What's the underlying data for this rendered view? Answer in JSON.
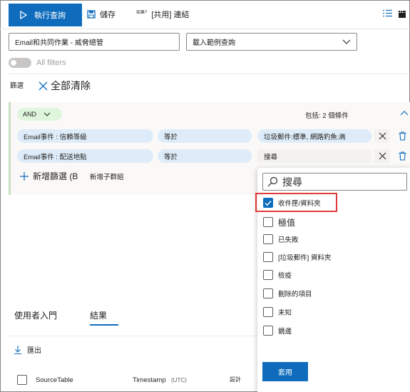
{
  "toolbar": {
    "run_query": "執行查詢",
    "save": "儲存",
    "share_prefix": "如果?",
    "share_link": "[共用] 連結"
  },
  "query": {
    "category_value": "Email和共同作業 - 威脅總管",
    "sample_query_value": "載入範例查詢"
  },
  "filters": {
    "all_filters_label": "All filters",
    "filter_label": "篩選",
    "clear_all": "全部清除",
    "logic_operator": "AND",
    "includes_summary": "包括: 2 個條件",
    "conditions": [
      {
        "field": "Email事件 : 信賴等級",
        "operator": "等於",
        "value": "垃圾郵件:標準, 網路釣魚:高"
      },
      {
        "field": "Email事件 : 配送地點",
        "operator": "等於",
        "value": "搜尋"
      }
    ],
    "add_filter": "新增篩選 (B",
    "add_subgroup": "新增子群組"
  },
  "dropdown": {
    "search_placeholder": "搜尋",
    "options": [
      {
        "label": "收件匣/資料夾",
        "checked": true
      },
      {
        "label": "極值",
        "checked": false
      },
      {
        "label": "已失敗",
        "checked": false
      },
      {
        "label": "[垃圾郵件] 資料夾",
        "checked": false
      },
      {
        "label": "檢疫",
        "checked": false
      },
      {
        "label": "刪除的項目",
        "checked": false
      },
      {
        "label": "未知",
        "checked": false
      },
      {
        "label": "鏡邊",
        "checked": false
      }
    ],
    "apply": "套用"
  },
  "tabs": [
    {
      "label": "使用者入門",
      "active": false
    },
    {
      "label": "結果",
      "active": true
    }
  ],
  "results": {
    "export": "匯出",
    "columns": [
      "SourceTable",
      "Timestamp",
      "(UTC)",
      "設計"
    ]
  },
  "colors": {
    "accent": "#0f6cbd",
    "highlight": "#e03a3a",
    "chip": "#deecf9",
    "and_pill": "#dff6dd"
  }
}
